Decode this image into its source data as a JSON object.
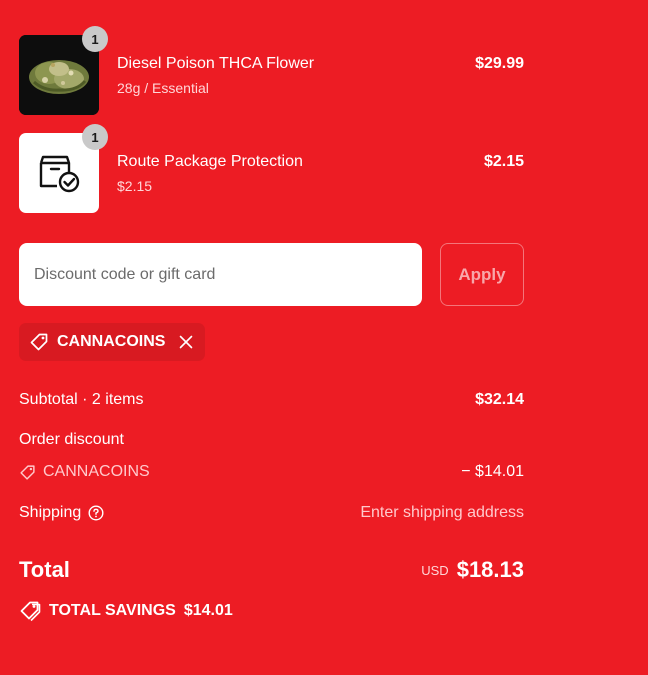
{
  "line_items": [
    {
      "name": "Diesel Poison THCA Flower",
      "variant": "28g / Essential",
      "price": "$29.99",
      "quantity": "1",
      "thumbnail_icon": "cannabis-flower-image"
    },
    {
      "name": "Route Package Protection",
      "variant": "$2.15",
      "price": "$2.15",
      "quantity": "1",
      "thumbnail_icon": "package-check-icon"
    }
  ],
  "discount": {
    "placeholder": "Discount code or gift card",
    "value": "",
    "apply_label": "Apply"
  },
  "applied_code": {
    "code": "CANNACOINS",
    "tag_icon": "tag-icon",
    "remove_icon": "close-icon"
  },
  "summary": {
    "subtotal_label": "Subtotal · 2 items",
    "subtotal_value": "$32.14",
    "order_discount_label": "Order discount",
    "discount_code": "CANNACOINS",
    "discount_value": "− $14.01",
    "shipping_label": "Shipping",
    "shipping_value": "Enter shipping address",
    "total_label": "Total",
    "total_currency": "USD",
    "total_value": "$18.13",
    "savings_label": "TOTAL SAVINGS",
    "savings_value": "$14.01"
  },
  "colors": {
    "background": "#ED1C24",
    "text": "#FFFFFF",
    "chip_background": "#D81A21"
  }
}
